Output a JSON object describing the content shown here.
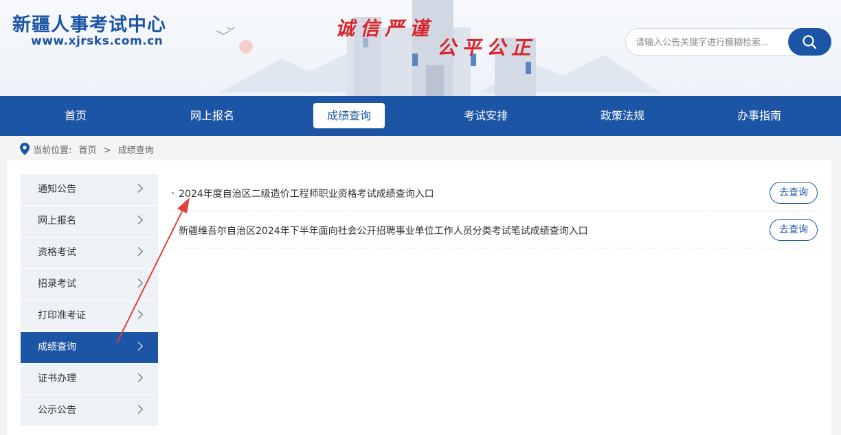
{
  "header": {
    "site_title": "新疆人事考试中心",
    "site_url": "www.xjrsks.com.cn",
    "slogan_1": "诚信严谨",
    "slogan_2": "公平公正",
    "search": {
      "placeholder": "请输入公告关键字进行模糊检索..."
    }
  },
  "nav": {
    "items": [
      "首页",
      "网上报名",
      "成绩查询",
      "考试安排",
      "政策法规",
      "办事指南"
    ],
    "active": "成绩查询"
  },
  "breadcrumb": {
    "label": "当前位置:",
    "home": "首页",
    "sep": ">",
    "current": "成绩查询"
  },
  "sidebar": {
    "items": [
      "通知公告",
      "网上报名",
      "资格考试",
      "招录考试",
      "打印准考证",
      "成绩查询",
      "证书办理",
      "公示公告"
    ],
    "active": "成绩查询"
  },
  "list": {
    "items": [
      {
        "title": "2024年度自治区二级造价工程师职业资格考试成绩查询入口",
        "action": "去查询"
      },
      {
        "title": "新疆维吾尔自治区2024年下半年面向社会公开招聘事业单位工作人员分类考试笔试成绩查询入口",
        "action": "去查询"
      }
    ]
  },
  "colors": {
    "brand": "#1d55a6",
    "slogan": "#d9252b",
    "annotation_arrow": "#e0413c"
  },
  "icons": {
    "search": "search-icon",
    "location": "location-pin-icon",
    "chevron": "chevron-right-icon"
  }
}
